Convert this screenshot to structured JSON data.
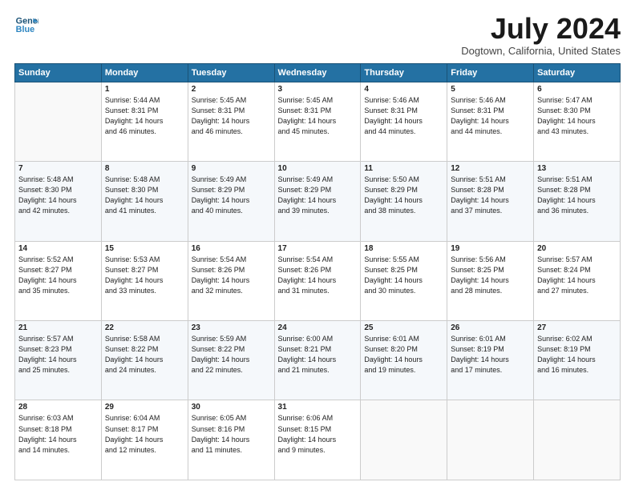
{
  "header": {
    "logo_line1": "General",
    "logo_line2": "Blue",
    "month_title": "July 2024",
    "location": "Dogtown, California, United States"
  },
  "weekdays": [
    "Sunday",
    "Monday",
    "Tuesday",
    "Wednesday",
    "Thursday",
    "Friday",
    "Saturday"
  ],
  "weeks": [
    [
      {
        "day": "",
        "info": ""
      },
      {
        "day": "1",
        "info": "Sunrise: 5:44 AM\nSunset: 8:31 PM\nDaylight: 14 hours\nand 46 minutes."
      },
      {
        "day": "2",
        "info": "Sunrise: 5:45 AM\nSunset: 8:31 PM\nDaylight: 14 hours\nand 46 minutes."
      },
      {
        "day": "3",
        "info": "Sunrise: 5:45 AM\nSunset: 8:31 PM\nDaylight: 14 hours\nand 45 minutes."
      },
      {
        "day": "4",
        "info": "Sunrise: 5:46 AM\nSunset: 8:31 PM\nDaylight: 14 hours\nand 44 minutes."
      },
      {
        "day": "5",
        "info": "Sunrise: 5:46 AM\nSunset: 8:31 PM\nDaylight: 14 hours\nand 44 minutes."
      },
      {
        "day": "6",
        "info": "Sunrise: 5:47 AM\nSunset: 8:30 PM\nDaylight: 14 hours\nand 43 minutes."
      }
    ],
    [
      {
        "day": "7",
        "info": "Sunrise: 5:48 AM\nSunset: 8:30 PM\nDaylight: 14 hours\nand 42 minutes."
      },
      {
        "day": "8",
        "info": "Sunrise: 5:48 AM\nSunset: 8:30 PM\nDaylight: 14 hours\nand 41 minutes."
      },
      {
        "day": "9",
        "info": "Sunrise: 5:49 AM\nSunset: 8:29 PM\nDaylight: 14 hours\nand 40 minutes."
      },
      {
        "day": "10",
        "info": "Sunrise: 5:49 AM\nSunset: 8:29 PM\nDaylight: 14 hours\nand 39 minutes."
      },
      {
        "day": "11",
        "info": "Sunrise: 5:50 AM\nSunset: 8:29 PM\nDaylight: 14 hours\nand 38 minutes."
      },
      {
        "day": "12",
        "info": "Sunrise: 5:51 AM\nSunset: 8:28 PM\nDaylight: 14 hours\nand 37 minutes."
      },
      {
        "day": "13",
        "info": "Sunrise: 5:51 AM\nSunset: 8:28 PM\nDaylight: 14 hours\nand 36 minutes."
      }
    ],
    [
      {
        "day": "14",
        "info": "Sunrise: 5:52 AM\nSunset: 8:27 PM\nDaylight: 14 hours\nand 35 minutes."
      },
      {
        "day": "15",
        "info": "Sunrise: 5:53 AM\nSunset: 8:27 PM\nDaylight: 14 hours\nand 33 minutes."
      },
      {
        "day": "16",
        "info": "Sunrise: 5:54 AM\nSunset: 8:26 PM\nDaylight: 14 hours\nand 32 minutes."
      },
      {
        "day": "17",
        "info": "Sunrise: 5:54 AM\nSunset: 8:26 PM\nDaylight: 14 hours\nand 31 minutes."
      },
      {
        "day": "18",
        "info": "Sunrise: 5:55 AM\nSunset: 8:25 PM\nDaylight: 14 hours\nand 30 minutes."
      },
      {
        "day": "19",
        "info": "Sunrise: 5:56 AM\nSunset: 8:25 PM\nDaylight: 14 hours\nand 28 minutes."
      },
      {
        "day": "20",
        "info": "Sunrise: 5:57 AM\nSunset: 8:24 PM\nDaylight: 14 hours\nand 27 minutes."
      }
    ],
    [
      {
        "day": "21",
        "info": "Sunrise: 5:57 AM\nSunset: 8:23 PM\nDaylight: 14 hours\nand 25 minutes."
      },
      {
        "day": "22",
        "info": "Sunrise: 5:58 AM\nSunset: 8:22 PM\nDaylight: 14 hours\nand 24 minutes."
      },
      {
        "day": "23",
        "info": "Sunrise: 5:59 AM\nSunset: 8:22 PM\nDaylight: 14 hours\nand 22 minutes."
      },
      {
        "day": "24",
        "info": "Sunrise: 6:00 AM\nSunset: 8:21 PM\nDaylight: 14 hours\nand 21 minutes."
      },
      {
        "day": "25",
        "info": "Sunrise: 6:01 AM\nSunset: 8:20 PM\nDaylight: 14 hours\nand 19 minutes."
      },
      {
        "day": "26",
        "info": "Sunrise: 6:01 AM\nSunset: 8:19 PM\nDaylight: 14 hours\nand 17 minutes."
      },
      {
        "day": "27",
        "info": "Sunrise: 6:02 AM\nSunset: 8:19 PM\nDaylight: 14 hours\nand 16 minutes."
      }
    ],
    [
      {
        "day": "28",
        "info": "Sunrise: 6:03 AM\nSunset: 8:18 PM\nDaylight: 14 hours\nand 14 minutes."
      },
      {
        "day": "29",
        "info": "Sunrise: 6:04 AM\nSunset: 8:17 PM\nDaylight: 14 hours\nand 12 minutes."
      },
      {
        "day": "30",
        "info": "Sunrise: 6:05 AM\nSunset: 8:16 PM\nDaylight: 14 hours\nand 11 minutes."
      },
      {
        "day": "31",
        "info": "Sunrise: 6:06 AM\nSunset: 8:15 PM\nDaylight: 14 hours\nand 9 minutes."
      },
      {
        "day": "",
        "info": ""
      },
      {
        "day": "",
        "info": ""
      },
      {
        "day": "",
        "info": ""
      }
    ]
  ]
}
